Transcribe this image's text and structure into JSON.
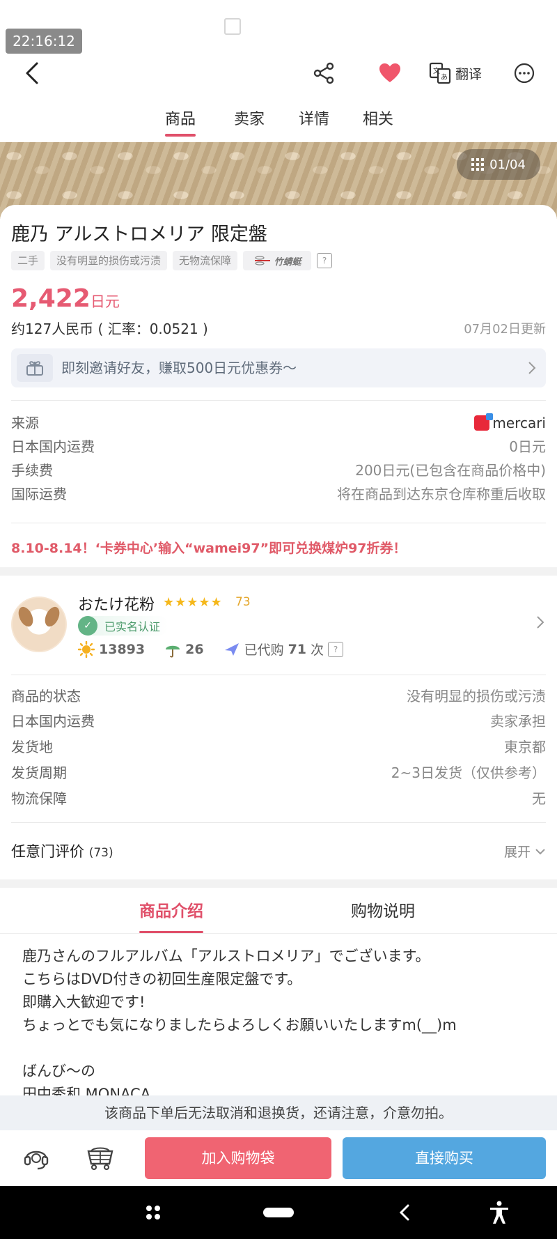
{
  "status": {
    "time": "22:16:12"
  },
  "header": {
    "translate_label": "翻译",
    "tabs": [
      {
        "label": "商品",
        "active": true
      },
      {
        "label": "卖家",
        "active": false
      },
      {
        "label": "详情",
        "active": false
      },
      {
        "label": "相关",
        "active": false
      }
    ]
  },
  "gallery": {
    "counter": "01/04"
  },
  "product": {
    "title": "鹿乃 アルストロメリア 限定盤",
    "tags": [
      "二手",
      "没有明显的损伤或污渍",
      "无物流保障"
    ],
    "carrier_tag": "竹蜻蜓",
    "price_number": "2,422",
    "price_unit": "日元",
    "rmb_text": "约127人民币 ( 汇率：0.0521 )",
    "updated": "07月02日更新",
    "invite_text": "即刻邀请好友，赚取500日元优惠券～",
    "fees": [
      {
        "key": "来源",
        "value": "mercari"
      },
      {
        "key": "日本国内运费",
        "value": "0日元"
      },
      {
        "key": "手续费",
        "value": "200日元(已包含在商品价格中)"
      },
      {
        "key": "国际运费",
        "value": "将在商品到达东京仓库称重后收取"
      }
    ],
    "promo": "8.10-8.14！‘卡券中心’输入“wamei97”即可兑换煤炉97折券！"
  },
  "seller": {
    "name": "おたけ花粉",
    "stars": "★★★★★",
    "rating_count": "73",
    "verified_label": "已实名认证",
    "sun_count": "13893",
    "umbrella_count": "26",
    "purchased_prefix": "已代购",
    "purchased_count": "71",
    "purchased_suffix": "次"
  },
  "details": [
    {
      "key": "商品的状态",
      "value": "没有明显的损伤或污渍"
    },
    {
      "key": "日本国内运费",
      "value": "卖家承担"
    },
    {
      "key": "发货地",
      "value": "東京都"
    },
    {
      "key": "发货周期",
      "value": "2~3日发货（仅供参考）"
    },
    {
      "key": "物流保障",
      "value": "无"
    }
  ],
  "reviews": {
    "title": "任意门评价",
    "count": "(73)",
    "expand": "展开"
  },
  "description": {
    "tabs": [
      {
        "label": "商品介绍",
        "active": true
      },
      {
        "label": "购物说明",
        "active": false
      }
    ],
    "lines": [
      "鹿乃さんのフルアルバム「アルストロメリア」でございます。",
      "こちらはDVD付きの初回生産限定盤です。",
      "即購入大歓迎です!",
      "ちょっとでも気になりましたらよろしくお願いいたしますm(__)m",
      "",
      "ばんび～の",
      "田中秀和 MONACA"
    ]
  },
  "notice": "该商品下单后无法取消和退换货，还请注意，介意勿拍。",
  "actions": {
    "add_to_bag": "加入购物袋",
    "buy_now": "直接购买"
  },
  "colors": {
    "accent": "#e0506a",
    "buy_blue": "#54a7e0",
    "cart_pink": "#f06472"
  }
}
